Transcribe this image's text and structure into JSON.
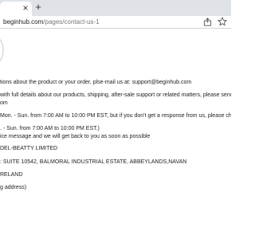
{
  "browser": {
    "tab_close_glyph": "×",
    "new_tab_glyph": "+",
    "url_host": "beginhub.com",
    "url_path": "/pages/contact-us-1"
  },
  "content": {
    "line1": "tions about the product or your order, plse-mail us at: support@beginhub.com",
    "line2": "with full details about our products, shipping, after-sale support or related matters, please send an emai",
    "line3": "om",
    "line4": "Mon. - Sun. from 7:00 AM to 10:00 PM EST, but if you don't get a response from us, please check your s",
    "line5": ". - Sun. from 7:00 AM to 10:00 PM EST.)",
    "line6": "ice message and we will get back to you as soon as possible",
    "line7": "DEL-BEATTY LIMITED",
    "line8": ": SUITE 10542, BALMORAL INDUSTRIAL ESTATE, ABBEYLANDS,NAVAN",
    "line9": "RELAND",
    "line10": "g address)"
  },
  "colors": {
    "tabbar_bg": "#dfe3e8",
    "text": "#222222",
    "url_path": "#777777"
  }
}
